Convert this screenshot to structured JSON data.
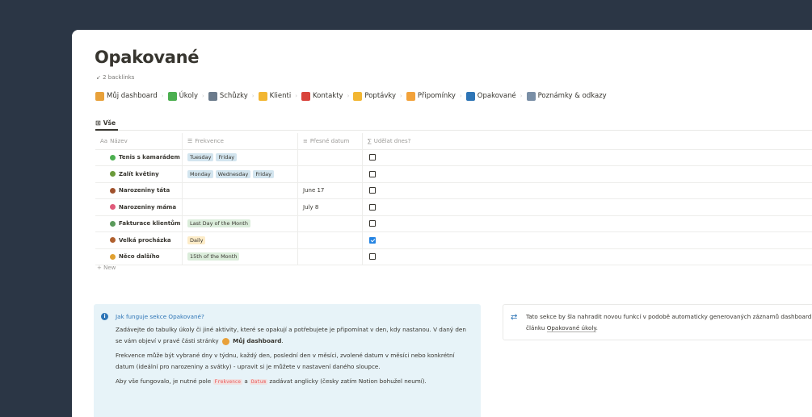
{
  "page": {
    "title": "Opakované",
    "backlinks": "2 backlinks"
  },
  "nav": [
    {
      "label": "Můj dashboard",
      "icon": "search-clock-icon",
      "color": "#e8a13a"
    },
    {
      "label": "Úkoly",
      "icon": "checkmark-icon",
      "color": "#4caf50"
    },
    {
      "label": "Schůzky",
      "icon": "people-icon",
      "color": "#6b7b8c"
    },
    {
      "label": "Klienti",
      "icon": "handshake-icon",
      "color": "#f2b632"
    },
    {
      "label": "Kontakty",
      "icon": "phone-icon",
      "color": "#d9433b"
    },
    {
      "label": "Poptávky",
      "icon": "pointing-hand-icon",
      "color": "#f2b632"
    },
    {
      "label": "Připomínky",
      "icon": "bell-icon",
      "color": "#f2a23a"
    },
    {
      "label": "Opakované",
      "icon": "repeat-calendar-icon",
      "color": "#2e75b6"
    },
    {
      "label": "Poznámky & odkazy",
      "icon": "notepad-icon",
      "color": "#7a8fa6"
    }
  ],
  "view_tab": "Vše",
  "table": {
    "columns": [
      "Název",
      "Frekvence",
      "Přesné datum",
      "Udělat dnes?"
    ],
    "column_icons": [
      "Aa",
      "list-icon",
      "text-icon",
      "formula-icon"
    ],
    "rows": [
      {
        "name": "Tenis s kamarádem",
        "emoji_color": "#4caf50",
        "tags": [
          {
            "t": "Tuesday",
            "c": "blue"
          },
          {
            "t": "Friday",
            "c": "blue"
          }
        ],
        "date": "",
        "done": false
      },
      {
        "name": "Zalít květiny",
        "emoji_color": "#6a9a3a",
        "tags": [
          {
            "t": "Monday",
            "c": "blue"
          },
          {
            "t": "Wednesday",
            "c": "blue"
          },
          {
            "t": "Friday",
            "c": "blue"
          }
        ],
        "date": "",
        "done": false
      },
      {
        "name": "Narozeniny táta",
        "emoji_color": "#a0522d",
        "tags": [],
        "date": "June 17",
        "done": false
      },
      {
        "name": "Narozeniny máma",
        "emoji_color": "#e05a7a",
        "tags": [],
        "date": "July 8",
        "done": false
      },
      {
        "name": "Fakturace klientům",
        "emoji_color": "#5a9a5a",
        "tags": [
          {
            "t": "Last Day of the Month",
            "c": "green"
          }
        ],
        "date": "",
        "done": false
      },
      {
        "name": "Velká procházka",
        "emoji_color": "#b0602e",
        "tags": [
          {
            "t": "Daily",
            "c": "yellow"
          }
        ],
        "date": "",
        "done": true
      },
      {
        "name": "Něco dalšího",
        "emoji_color": "#e0a030",
        "tags": [
          {
            "t": "15th of the Month",
            "c": "green"
          }
        ],
        "date": "",
        "done": false
      }
    ],
    "new_label": "+ New"
  },
  "callout_info": {
    "heading": "Jak funguje sekce Opakované?",
    "p1_a": "Zadávejte do tabulky úkoly či jiné aktivity, které se opakují a potřebujete je připomínat v den, kdy nastanou. V daný den se vám objeví v pravé části stránky",
    "p1_link": "Můj dashboard",
    "p2": "Frekvence může být vybrané dny v týdnu, každý den, poslední den v měsíci, zvolené datum v měsíci nebo konkrétní datum (ideální pro narozeniny a svátky) - upravit si je můžete v nastavení daného sloupce.",
    "p3_a": "Aby vše fungovalo, je nutné pole",
    "p3_code1": "Frekvence",
    "p3_and": "a",
    "p3_code2": "Datum",
    "p3_b": "zadávat anglicky (česky zatím Notion bohužel neumí)."
  },
  "callout_sync": {
    "text_a": "Tato sekce by šla nahradit novou funkcí v podobě automaticky generovaných záznamů dashboard. Více v článku",
    "link": "Opakované úkoly",
    "text_b": "."
  }
}
